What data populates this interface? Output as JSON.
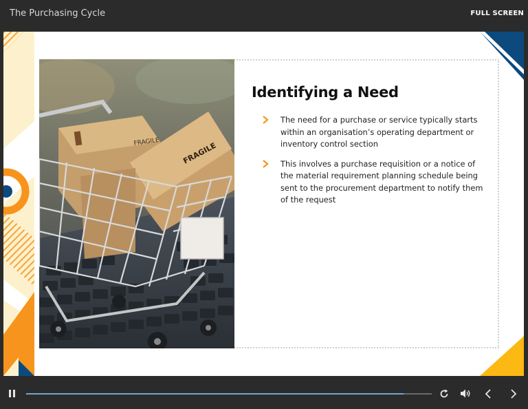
{
  "header": {
    "course_title": "The Purchasing Cycle",
    "fullscreen_label": "FULL SCREEN"
  },
  "slide": {
    "title": "Identifying a Need",
    "bullets": [
      "The need for a purchase or service typically starts within an organisation’s operating department or inventory control section",
      "This involves a purchase requisition or a notice of the material requirement planning schedule being sent to the procurement department to notify them of the request"
    ],
    "image_description": "shopping-cart-with-fragile-boxes-on-keyboard",
    "box_label": "FRAGILE",
    "accent_colors": {
      "orange": "#f7941d",
      "navy": "#0c4a7d",
      "yellow": "#fcb813",
      "cream": "#fdf1cd"
    }
  },
  "player": {
    "progress": 0.93,
    "icons": [
      "pause-icon",
      "replay-icon",
      "volume-icon",
      "previous-icon",
      "next-icon"
    ]
  }
}
